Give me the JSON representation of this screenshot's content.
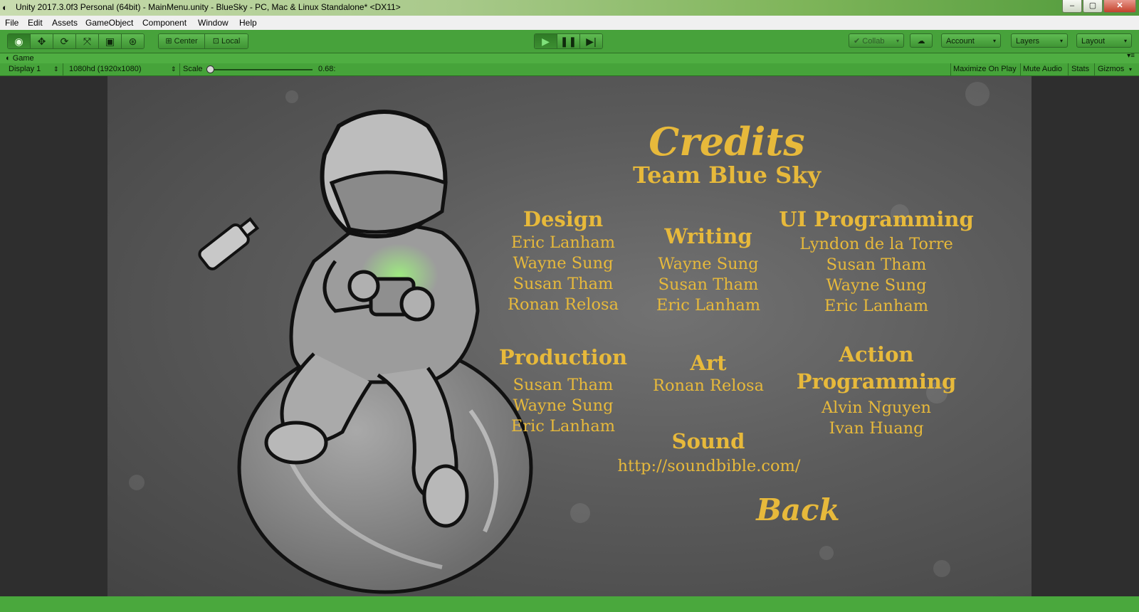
{
  "window": {
    "title": "Unity 2017.3.0f3 Personal (64bit) - MainMenu.unity - BlueSky - PC, Mac & Linux Standalone* <DX11>",
    "icon": "unity-logo-icon",
    "minimize": "–",
    "maximize": "▢",
    "close": "✕"
  },
  "menu": [
    "File",
    "Edit",
    "Assets",
    "GameObject",
    "Component",
    "Window",
    "Help"
  ],
  "toolbar": {
    "tools": [
      "hand-icon",
      "move-icon",
      "rotate-icon",
      "scale-icon",
      "rect-tool-icon",
      "transform-icon"
    ],
    "pivot": "Center",
    "space": "Local",
    "play": "play-icon",
    "pause": "pause-icon",
    "step": "step-icon",
    "collab": "Collab",
    "account": "Account",
    "layers": "Layers",
    "layout": "Layout",
    "caret": "▾"
  },
  "game_view": {
    "tab": "Game",
    "display": "Display 1",
    "resolution": "1080hd (1920x1080)",
    "scale_label": "Scale",
    "scale_value": "0.68:",
    "maximize": "Maximize On Play",
    "mute": "Mute Audio",
    "stats": "Stats",
    "gizmos": "Gizmos",
    "spinner": "⇕"
  },
  "credits": {
    "title": "Credits",
    "team": "Team Blue Sky",
    "design": {
      "title": "Design",
      "names": [
        "Eric Lanham",
        "Wayne Sung",
        "Susan Tham",
        "Ronan Relosa"
      ]
    },
    "writing": {
      "title": "Writing",
      "names": [
        "Wayne Sung",
        "Susan Tham",
        "Eric Lanham"
      ]
    },
    "ui": {
      "title": "UI Programming",
      "names": [
        "Lyndon de la Torre",
        "Susan Tham",
        "Wayne Sung",
        "Eric Lanham"
      ]
    },
    "production": {
      "title": "Production",
      "names": [
        "Susan Tham",
        "Wayne Sung",
        "Eric Lanham"
      ]
    },
    "art": {
      "title": "Art",
      "names": [
        "Ronan Relosa"
      ]
    },
    "action": {
      "title_line1": "Action",
      "title_line2": "Programming",
      "names": [
        "Alvin Nguyen",
        "Ivan Huang"
      ]
    },
    "sound": {
      "title": "Sound",
      "url": "http://soundbible.com/"
    },
    "back": "Back"
  },
  "colors": {
    "accent_gold": "#e7b93b",
    "editor_green": "#47a23b"
  }
}
